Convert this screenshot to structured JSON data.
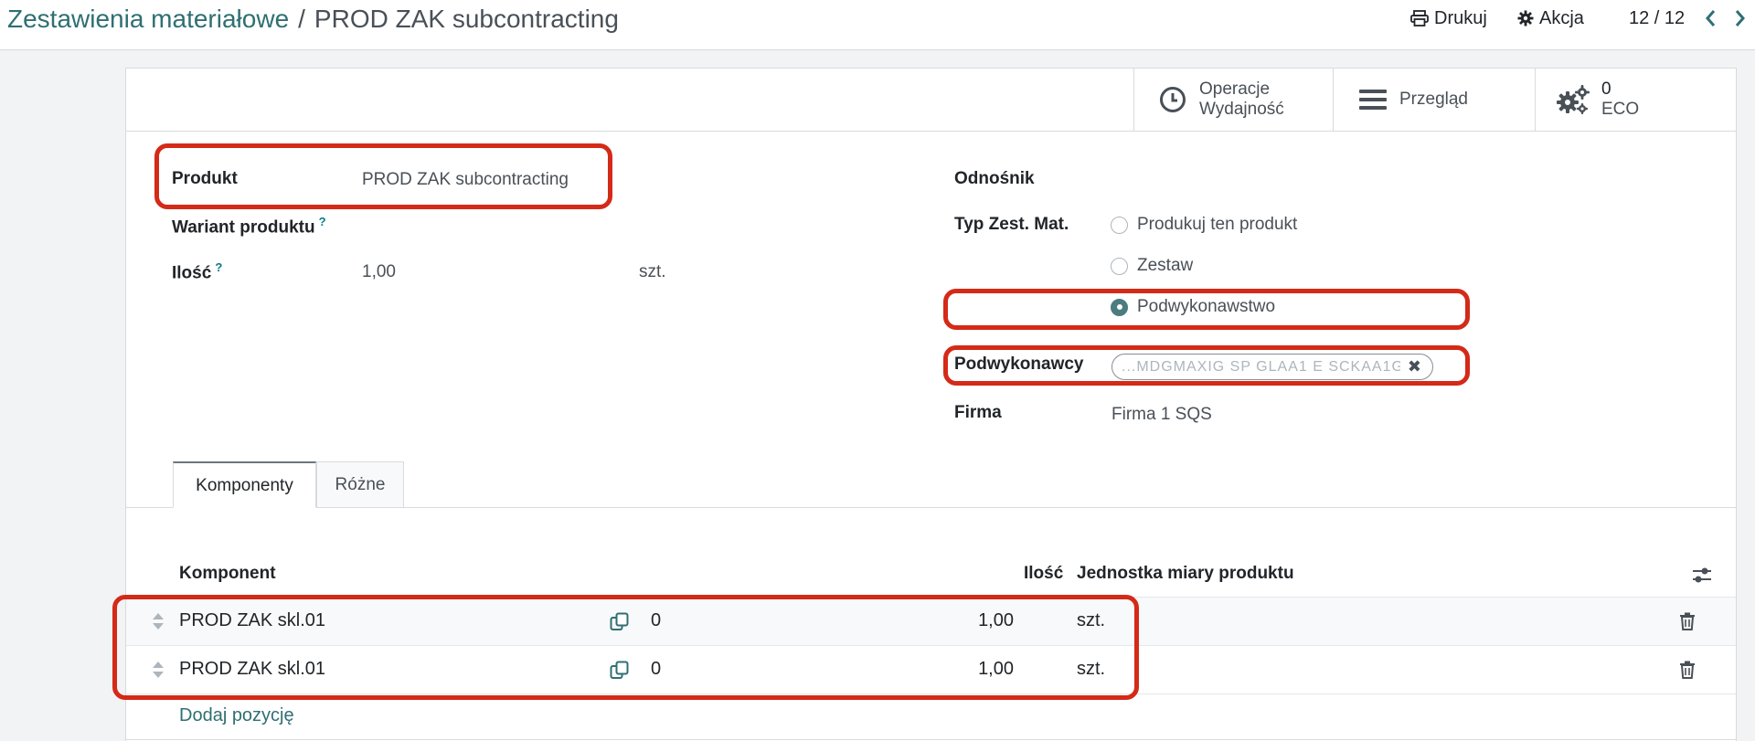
{
  "breadcrumb": {
    "parent": "Zestawienia materiałowe",
    "separator": "/",
    "current": "PROD ZAK subcontracting"
  },
  "toolbar": {
    "print_label": "Drukuj",
    "action_label": "Akcja"
  },
  "pager": {
    "value": "12 / 12"
  },
  "smart_buttons": {
    "operations_line1": "Operacje",
    "operations_line2": "Wydajność",
    "overview_label": "Przegląd",
    "eco_count": "0",
    "eco_label": "ECO"
  },
  "form": {
    "product_label": "Produkt",
    "product_value": "PROD ZAK subcontracting",
    "variant_label": "Wariant produktu",
    "variant_help": "?",
    "qty_label": "Ilość",
    "qty_help": "?",
    "qty_value": "1,00",
    "qty_uom": "szt.",
    "reference_label": "Odnośnik",
    "bom_type_label": "Typ Zest. Mat.",
    "bom_type_options": [
      {
        "label": "Produkuj ten produkt",
        "selected": false
      },
      {
        "label": "Zestaw",
        "selected": false
      },
      {
        "label": "Podwykonawstwo",
        "selected": true
      }
    ],
    "subcontractors_label": "Podwykonawcy",
    "subcontractor_tag": "...MDGMAXIG SP GLAA1 E SCKAA1G...",
    "company_label": "Firma",
    "company_value": "Firma 1 SQS"
  },
  "tabs": [
    {
      "label": "Komponenty",
      "active": true
    },
    {
      "label": "Różne",
      "active": false
    }
  ],
  "table": {
    "headers": {
      "component": "Komponent",
      "qty": "Ilość",
      "uom": "Jednostka miary produktu"
    },
    "rows": [
      {
        "component": "PROD ZAK skl.01",
        "stock": "0",
        "qty": "1,00",
        "uom": "szt."
      },
      {
        "component": "PROD ZAK skl.01",
        "stock": "0",
        "qty": "1,00",
        "uom": "szt."
      }
    ],
    "add_line_label": "Dodaj pozycję"
  },
  "colors": {
    "accent": "#017e84",
    "highlight": "#d42a17",
    "link": "#2f6f73"
  }
}
